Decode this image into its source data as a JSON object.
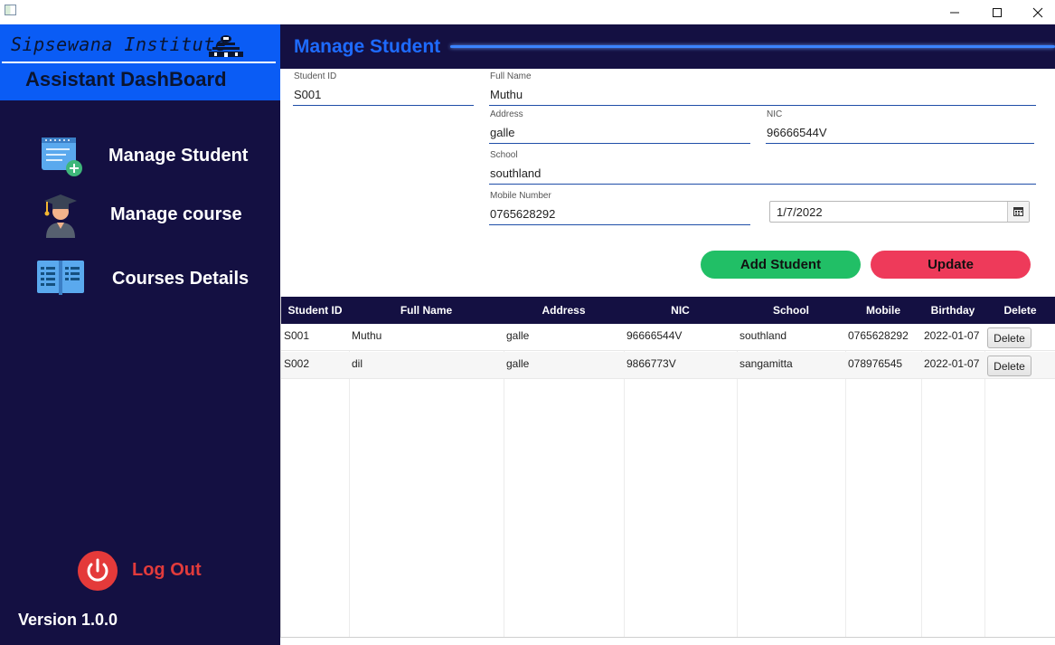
{
  "window": {
    "minimize_icon": "minimize-icon",
    "maximize_icon": "maximize-icon",
    "close_icon": "close-icon"
  },
  "sidebar": {
    "brand_name": "Sipsewana Institute",
    "brand_subtitle": "Assistant DashBoard",
    "items": [
      {
        "label": "Manage Student",
        "icon": "notepad-add-icon"
      },
      {
        "label": "Manage course",
        "icon": "graduate-icon"
      },
      {
        "label": "Courses Details",
        "icon": "open-book-icon"
      }
    ],
    "logout_label": "Log Out",
    "version": "Version 1.0.0",
    "colors": {
      "background": "#141042",
      "brand": "#0a5cf5",
      "logout": "#e23b3b"
    }
  },
  "header": {
    "title": "Manage Student",
    "color": "#1e6bff"
  },
  "form": {
    "student_id": {
      "label": "Student ID",
      "value": "S001"
    },
    "full_name": {
      "label": "Full Name",
      "value": "Muthu"
    },
    "address": {
      "label": "Address",
      "value": "galle"
    },
    "nic": {
      "label": "NIC",
      "value": "96666544V"
    },
    "school": {
      "label": "School",
      "value": "southland"
    },
    "mobile": {
      "label": "Mobile Number",
      "value": "0765628292"
    },
    "birthday": {
      "value": "1/7/2022"
    },
    "add_button": "Add Student",
    "update_button": "Update",
    "colors": {
      "add": "#21bf66",
      "update": "#ee3a5a"
    }
  },
  "table": {
    "headers": [
      "Student ID",
      "Full Name",
      "Address",
      "NIC",
      "School",
      "Mobile",
      "Birthday",
      "Delete"
    ],
    "rows": [
      {
        "id": "S001",
        "name": "Muthu",
        "address": "galle",
        "nic": "96666544V",
        "school": "southland",
        "mobile": "0765628292",
        "birthday": "2022-01-07",
        "delete": "Delete"
      },
      {
        "id": "S002",
        "name": "dil",
        "address": "galle",
        "nic": "9866773V",
        "school": "sangamitta",
        "mobile": "078976545",
        "birthday": "2022-01-07",
        "delete": "Delete"
      }
    ]
  }
}
